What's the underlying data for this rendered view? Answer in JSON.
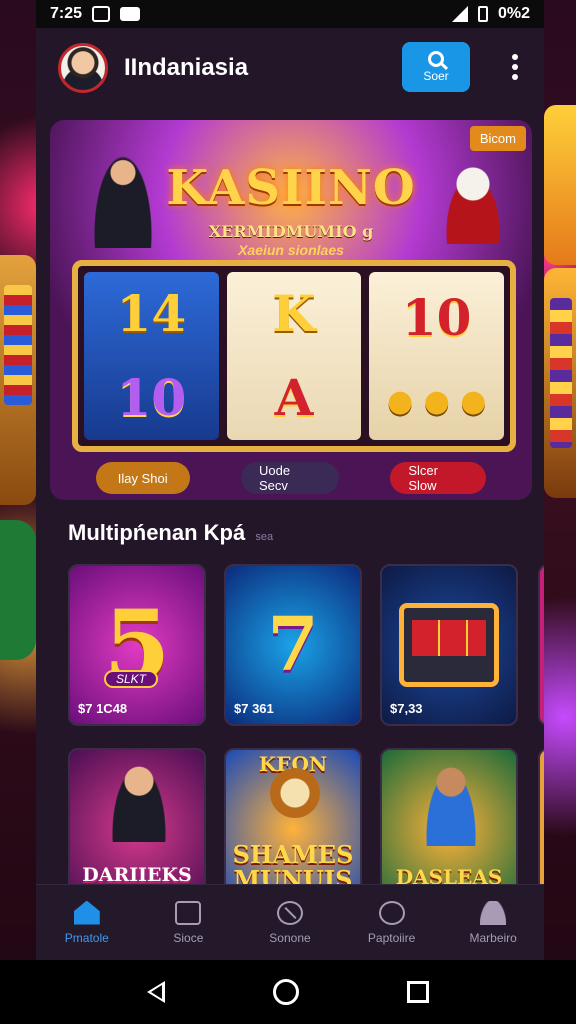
{
  "status": {
    "time": "7:25",
    "battery_text": "0%2"
  },
  "header": {
    "title": "IIndaniasia",
    "search_label": "Soer"
  },
  "hero": {
    "badge": "Bicom",
    "title": "KASIINO",
    "subtitle": "XERMIDMUMIO g",
    "subtitle2": "Xaeiun sionlaes",
    "reels": [
      {
        "top": "14",
        "bottom": "10"
      },
      {
        "top": "K",
        "bottom": "A"
      },
      {
        "top": "10",
        "bottom": ""
      }
    ],
    "actions": [
      "Ilay Shoi",
      "Uode Secv",
      "Slcer Slow"
    ]
  },
  "section": {
    "title": "Multipńenan Kpá",
    "tag": "sea"
  },
  "games": [
    {
      "art": "5",
      "tag": "SLKT",
      "price": "$7 1C48"
    },
    {
      "art": "7",
      "price": "$7 361"
    },
    {
      "art": "",
      "price": "$7,33"
    },
    {
      "art": "DARIIEKS",
      "price": ""
    },
    {
      "art": "SHAMES MUNUIS",
      "top_text": "KEON",
      "price": ""
    },
    {
      "art": "DASLEAS",
      "price": ""
    }
  ],
  "bottom_nav": [
    {
      "label": "Pmatole",
      "icon": "home-icon",
      "active": true
    },
    {
      "label": "Sioce",
      "icon": "cast-icon",
      "active": false
    },
    {
      "label": "Sonone",
      "icon": "ball-icon",
      "active": false
    },
    {
      "label": "Paptoiire",
      "icon": "chat-icon",
      "active": false
    },
    {
      "label": "Marbeiro",
      "icon": "profile-icon",
      "active": false
    }
  ],
  "colors": {
    "accent": "#1a96e6",
    "nav_active": "#3d9bf0",
    "app_bg": "#231629"
  }
}
